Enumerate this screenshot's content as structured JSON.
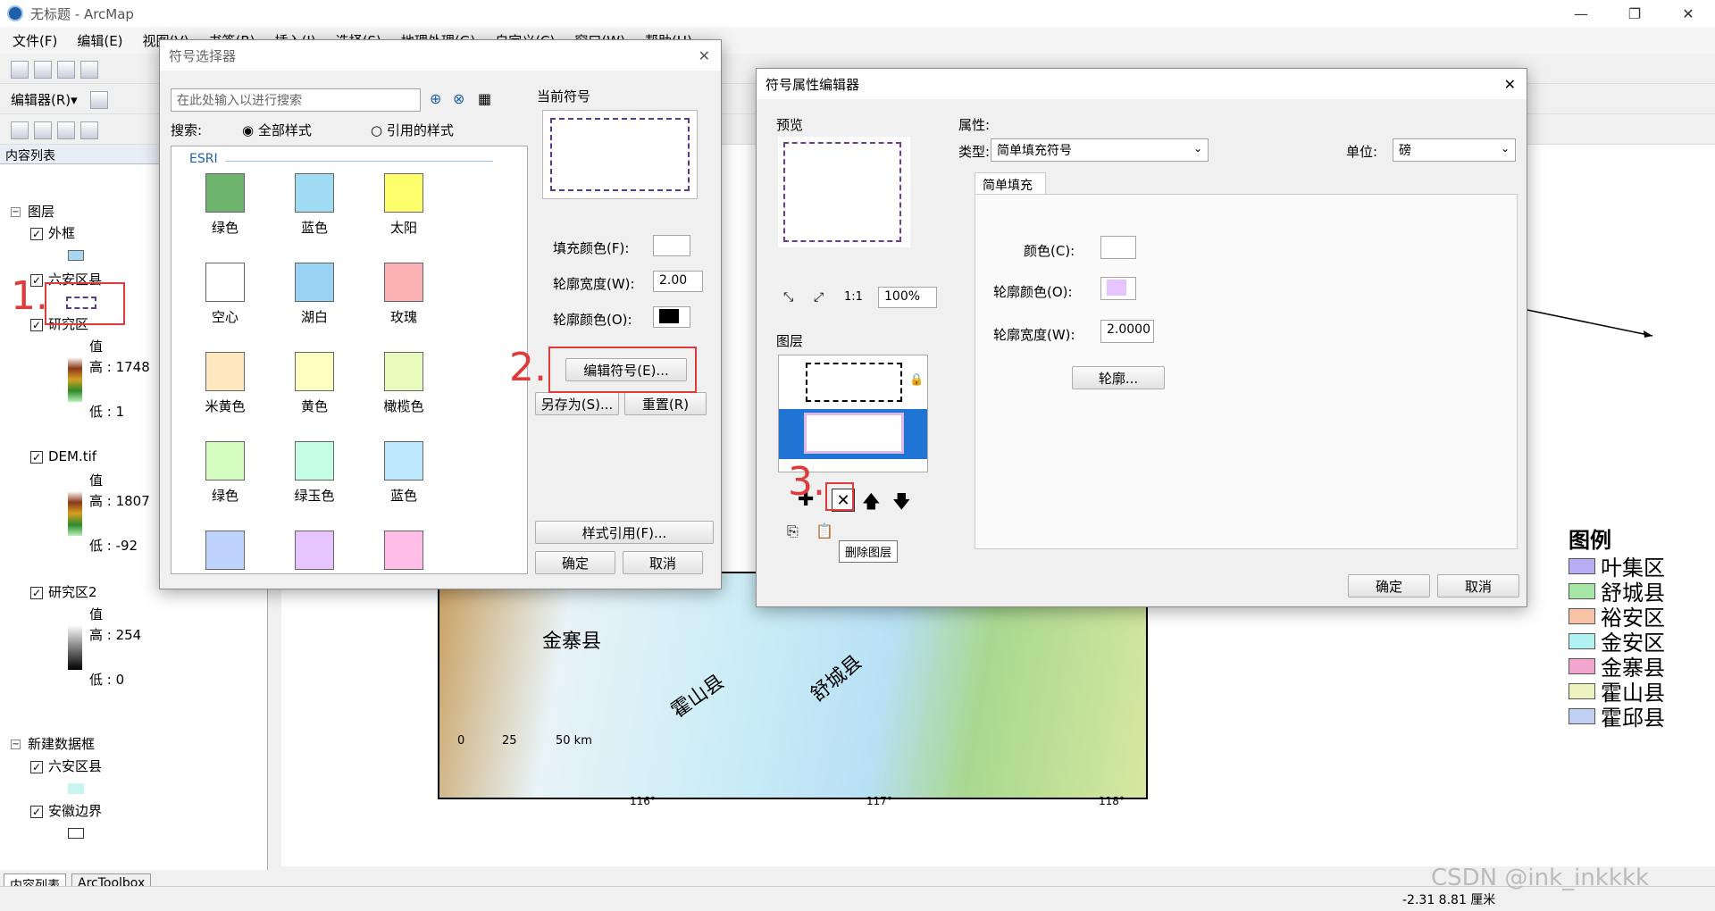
{
  "window": {
    "title": "无标题 - ArcMap",
    "minimize": "—",
    "restore": "❐",
    "close": "✕"
  },
  "menu": [
    "文件(F)",
    "编辑(E)",
    "视图(V)",
    "书签(B)",
    "插入(I)",
    "选择(S)",
    "地理处理(G)",
    "自定义(C)",
    "窗口(W)",
    "帮助(H)"
  ],
  "editor_toolbar": {
    "label": "编辑器(R)▾"
  },
  "toc": {
    "title": "内容列表",
    "group_label": "图层",
    "layers": [
      {
        "name": "外框",
        "checked": true
      },
      {
        "name": "六安区县",
        "checked": true
      },
      {
        "name": "研究区",
        "checked": true,
        "value_label": "值",
        "high": "高 : 1748",
        "low": "低 : 1"
      },
      {
        "name": "DEM.tif",
        "checked": true,
        "value_label": "值",
        "high": "高 : 1807",
        "low": "低 : -92"
      },
      {
        "name": "研究区2",
        "checked": true,
        "value_label": "值",
        "high": "高 : 254",
        "low": "低 : 0"
      }
    ],
    "frame2_label": "新建数据框",
    "frame2_layers": [
      {
        "name": "六安区县",
        "checked": true
      },
      {
        "name": "安徽边界",
        "checked": true
      }
    ],
    "bottom_tabs": [
      "内容列表",
      "ArcToolbox"
    ]
  },
  "symbol_selector": {
    "title": "符号选择器",
    "search_placeholder": "在此处输入以进行搜索",
    "search_label": "搜索:",
    "radio_all": "全部样式",
    "radio_ref": "引用的样式",
    "category": "ESRI",
    "swatches": [
      {
        "label": "绿色",
        "color": "#6db36e"
      },
      {
        "label": "蓝色",
        "color": "#9fdcf4"
      },
      {
        "label": "太阳",
        "color": "#ffff6b"
      },
      {
        "label": "空心",
        "color": "#ffffff"
      },
      {
        "label": "湖白",
        "color": "#9ad3f5"
      },
      {
        "label": "玫瑰",
        "color": "#fcb2b2"
      },
      {
        "label": "米黄色",
        "color": "#ffe8c0"
      },
      {
        "label": "黄色",
        "color": "#ffffbf"
      },
      {
        "label": "橄榄色",
        "color": "#e6fbbc"
      },
      {
        "label": "绿色",
        "color": "#d4fdbf"
      },
      {
        "label": "绿玉色",
        "color": "#c3fde4"
      },
      {
        "label": "蓝色",
        "color": "#bde8fd"
      },
      {
        "label": "",
        "color": "#bfd3ff"
      },
      {
        "label": "",
        "color": "#e6c4ff"
      },
      {
        "label": "",
        "color": "#ffbde8"
      }
    ],
    "current_symbol_label": "当前符号",
    "fill_color_label": "填充颜色(F):",
    "outline_width_label": "轮廓宽度(W):",
    "outline_width_value": "2.00",
    "outline_color_label": "轮廓颜色(O):",
    "edit_symbol_button": "编辑符号(E)...",
    "save_as_button": "另存为(S)...",
    "reset_button": "重置(R)",
    "style_ref_button": "样式引用(F)...",
    "ok_button": "确定",
    "cancel_button": "取消"
  },
  "property_editor": {
    "title": "符号属性编辑器",
    "preview_label": "预览",
    "zoom_value": "100%",
    "layers_label": "图层",
    "properties_label": "属性:",
    "type_label": "类型:",
    "type_value": "简单填充符号",
    "unit_label": "单位:",
    "unit_value": "磅",
    "tab_label": "简单填充",
    "color_label": "颜色(C):",
    "outline_color_label": "轮廓颜色(O):",
    "outline_width_label": "轮廓宽度(W):",
    "outline_width_value": "2.0000",
    "outline_button": "轮廓...",
    "delete_tooltip": "删除图层",
    "ok_button": "确定",
    "cancel_button": "取消"
  },
  "annotations": {
    "one": "1.",
    "two": "2.",
    "three": "3."
  },
  "map": {
    "places": [
      "金寨县",
      "霍山县",
      "舒城县"
    ],
    "lon_ticks": [
      "116°",
      "117°",
      "118°"
    ],
    "scalebar": [
      "0",
      "25",
      "50 km"
    ],
    "legend_title": "图例",
    "legend": [
      {
        "label": "叶集区",
        "color": "#b9aef5"
      },
      {
        "label": "舒城县",
        "color": "#a6e6a6"
      },
      {
        "label": "裕安区",
        "color": "#f7c2a6"
      },
      {
        "label": "金安区",
        "color": "#b3f2f2"
      },
      {
        "label": "金寨县",
        "color": "#f2a6cf"
      },
      {
        "label": "霍山县",
        "color": "#ecf2c0"
      },
      {
        "label": "霍邱县",
        "color": "#bfd0f2"
      }
    ]
  },
  "status": {
    "coords": "-2.31  8.81 厘米",
    "watermark": "CSDN @ink_inkkkk"
  }
}
